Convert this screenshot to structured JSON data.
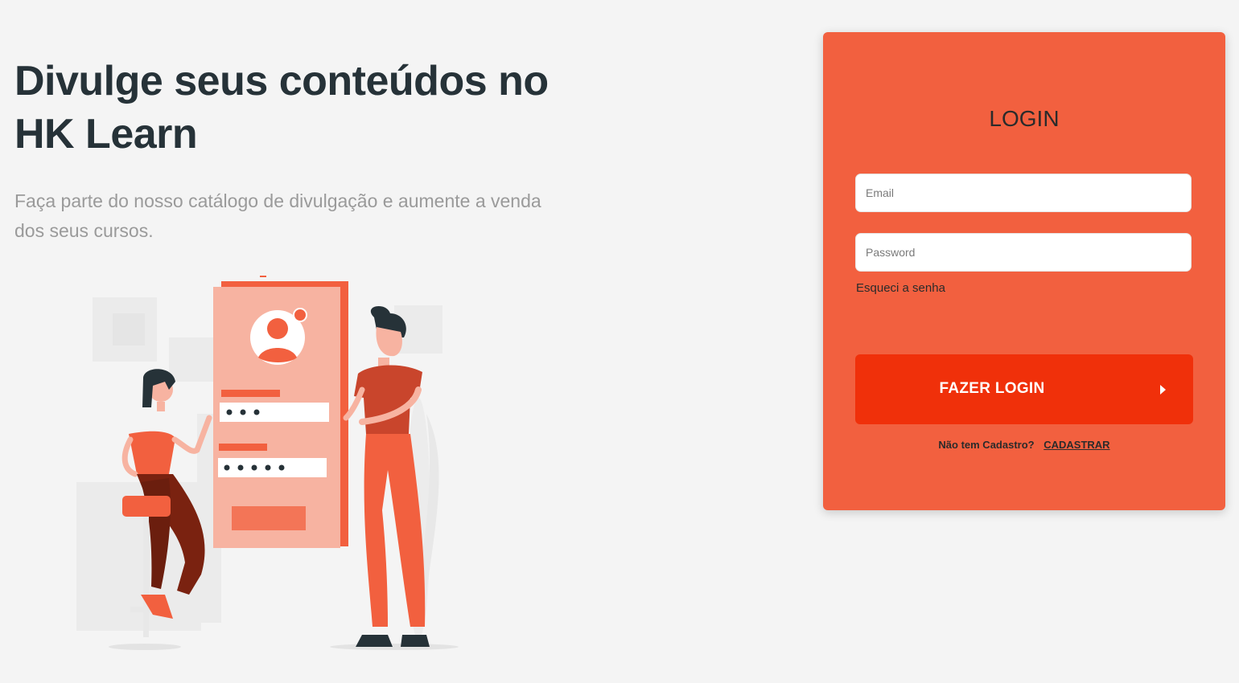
{
  "hero": {
    "title_line1": "Divulge seus conteúdos no",
    "title_line2": "HK Learn",
    "subtitle": "Faça parte do nosso catálogo de divulgação e aumente a venda dos seus cursos."
  },
  "login": {
    "title": "LOGIN",
    "email_placeholder": "Email",
    "password_placeholder": "Password",
    "forgot_label": "Esqueci a senha",
    "submit_label": "FAZER LOGIN",
    "no_account_text": "Não tem Cadastro?",
    "signup_label": "CADASTRAR"
  },
  "illustration": {
    "icon": "login-illustration-icon"
  },
  "colors": {
    "background": "#f4f4f4",
    "card": "#f2603f",
    "button": "#f0300a",
    "title_text": "#263238",
    "subtitle_text": "#9a9a9a"
  }
}
